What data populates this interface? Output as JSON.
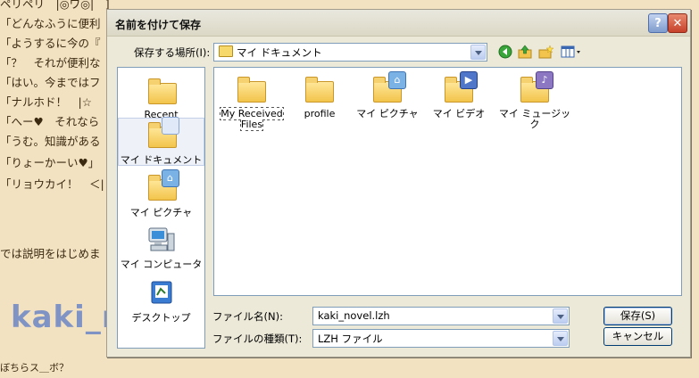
{
  "background": {
    "lines": [
      "ペリペリ　|◎ワ◎|　]",
      "「どんなふうに便利",
      "「ようするに今の『",
      "「？　それが便利な",
      "「はい。今まではフ",
      "「ナルホド！　|☆",
      "「へー♥　それなら",
      "「うむ。知識がある",
      "「りょーかーい♥」",
      "「リョウカイ！　＜|",
      "",
      "",
      "では説明をはじめま"
    ],
    "big_text": "kaki_n",
    "bottom_fragment": "ぼちらス＿ボ？"
  },
  "dialog": {
    "title": "名前を付けて保存",
    "help_label": "?",
    "close_label": "✕",
    "lookin_label": "保存する場所(I):",
    "lookin_value": "マイ ドキュメント",
    "toolbar_icons": [
      "back-icon",
      "up-folder-icon",
      "new-folder-icon",
      "views-menu-icon"
    ],
    "places": [
      {
        "label": "Recent",
        "icon": "recent-folder-icon",
        "selected": false
      },
      {
        "label": "マイ ドキュメント",
        "icon": "my-documents-icon",
        "selected": true
      },
      {
        "label": "マイ ピクチャ",
        "icon": "my-pictures-icon",
        "selected": false
      },
      {
        "label": "マイ コンピュータ",
        "icon": "my-computer-icon",
        "selected": false
      },
      {
        "label": "デスクトップ",
        "icon": "desktop-icon",
        "selected": false
      }
    ],
    "files": [
      {
        "label": "My Received Files",
        "icon": "folder-icon"
      },
      {
        "label": "profile",
        "icon": "folder-icon"
      },
      {
        "label": "マイ ピクチャ",
        "icon": "pictures-folder-icon"
      },
      {
        "label": "マイ ビデオ",
        "icon": "video-folder-icon"
      },
      {
        "label": "マイ ミュージック",
        "icon": "music-folder-icon"
      }
    ],
    "filename_label": "ファイル名(N):",
    "filename_value": "kaki_novel.lzh",
    "filetype_label": "ファイルの種類(T):",
    "filetype_value": "LZH ファイル",
    "save_button": "保存(S)",
    "cancel_button": "キャンセル"
  },
  "colors": {
    "dialog_bg": "#ece9d8",
    "page_bg": "#f3e2c2",
    "accent_blue": "#7f9db9"
  }
}
